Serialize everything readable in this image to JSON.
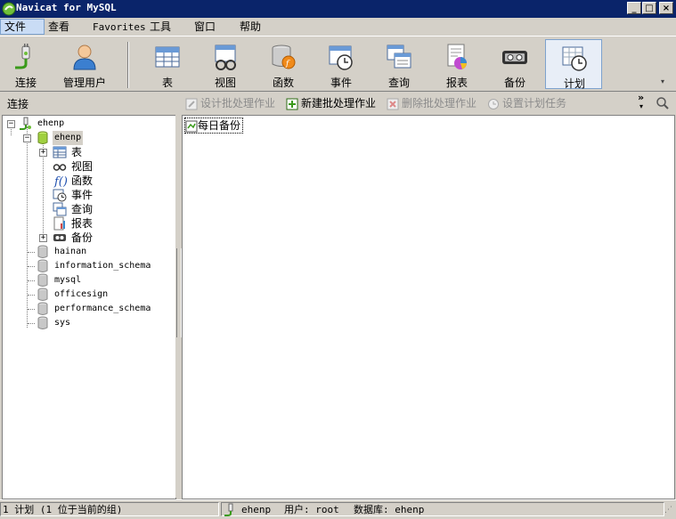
{
  "window": {
    "title": "Navicat for MySQL"
  },
  "menu": [
    "文件",
    "查看",
    "Favorites",
    "工具",
    "窗口",
    "帮助"
  ],
  "toolbar": {
    "buttons": [
      {
        "label": "连接",
        "icon": "connection-icon"
      },
      {
        "label": "管理用户",
        "icon": "user-icon"
      },
      {
        "label": "表",
        "icon": "table-icon"
      },
      {
        "label": "视图",
        "icon": "view-icon"
      },
      {
        "label": "函数",
        "icon": "function-icon"
      },
      {
        "label": "事件",
        "icon": "event-icon"
      },
      {
        "label": "查询",
        "icon": "query-icon"
      },
      {
        "label": "报表",
        "icon": "report-icon"
      },
      {
        "label": "备份",
        "icon": "backup-icon"
      },
      {
        "label": "计划",
        "icon": "schedule-icon"
      }
    ],
    "selected": "计划"
  },
  "subbar": {
    "label": "连接",
    "actions": [
      {
        "label": "设计批处理作业",
        "enabled": false
      },
      {
        "label": "新建批处理作业",
        "enabled": true
      },
      {
        "label": "删除批处理作业",
        "enabled": false
      },
      {
        "label": "设置计划任务",
        "enabled": false
      }
    ]
  },
  "tree": {
    "connection": "ehenp",
    "open_database": "ehenp",
    "children": [
      "表",
      "视图",
      "函数",
      "事件",
      "查询",
      "报表",
      "备份"
    ],
    "databases": [
      "hainan",
      "information_schema",
      "mysql",
      "officesign",
      "performance_schema",
      "sys"
    ]
  },
  "schedule": {
    "items": [
      "每日备份"
    ]
  },
  "status": {
    "count": "1 计划 (1 位于当前的组)",
    "connection": "ehenp",
    "user": "用户: root",
    "database": "数据库: ehenp"
  },
  "colors": {
    "titlebar": "#0a246a",
    "face": "#d4d0c8",
    "selection": "#c9dcf5"
  }
}
